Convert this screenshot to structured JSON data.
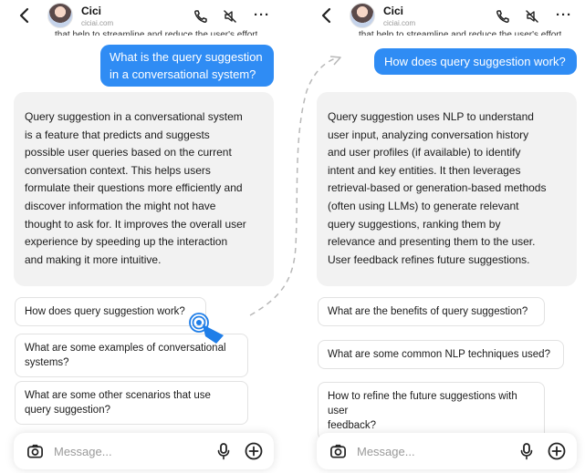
{
  "left": {
    "header": {
      "name": "Cici",
      "subtitle": "ciciai.com"
    },
    "clipped_text": "that help to streamline and reduce the user's effort",
    "user_message": "What is the query suggestion\nin a conversational system?",
    "assistant_message": "Query suggestion in a conversational system\nis a feature that predicts and suggests\npossible user queries based on the current\nconversation context. This helps users\nformulate their questions more efficiently and\ndiscover information the  might not have\nthought to ask for. It improves the overall user\nexperience by speeding up the interaction\nand making it more intuitive.",
    "suggestions": [
      "How does query suggestion work?",
      "What are some examples of conversational\nsystems?",
      "What are some other scenarios that use\nquery suggestion?"
    ],
    "input_placeholder": "Message..."
  },
  "right": {
    "header": {
      "name": "Cici",
      "subtitle": "ciciai.com"
    },
    "clipped_text": "that help to streamline and reduce the user's effort",
    "user_message": "How does query suggestion work?",
    "assistant_message": "Query suggestion uses NLP to understand\nuser input, analyzing conversation history\nand user profiles (if available) to identify\nintent and key entities.  It then leverages\nretrieval-based or generation-based methods\n(often using LLMs) to generate relevant\nquery suggestions, ranking them by\nrelevance and presenting them to the user.\nUser feedback refines future suggestions.",
    "suggestions": [
      "What are the benefits of query suggestion?",
      "What are some common NLP techniques used?",
      "How to refine the future suggestions with user\nfeedback?"
    ],
    "input_placeholder": "Message..."
  },
  "colors": {
    "user_bubble": "#2f8cf4",
    "assistant_bubble": "#f2f2f2",
    "connector": "#b8b8b8",
    "cursor_accent": "#1f7ee8"
  },
  "icons": [
    "back-icon",
    "avatar",
    "phone-icon",
    "mute-icon",
    "more-icon",
    "camera-icon",
    "mic-icon",
    "plus-icon",
    "cursor-icon"
  ]
}
